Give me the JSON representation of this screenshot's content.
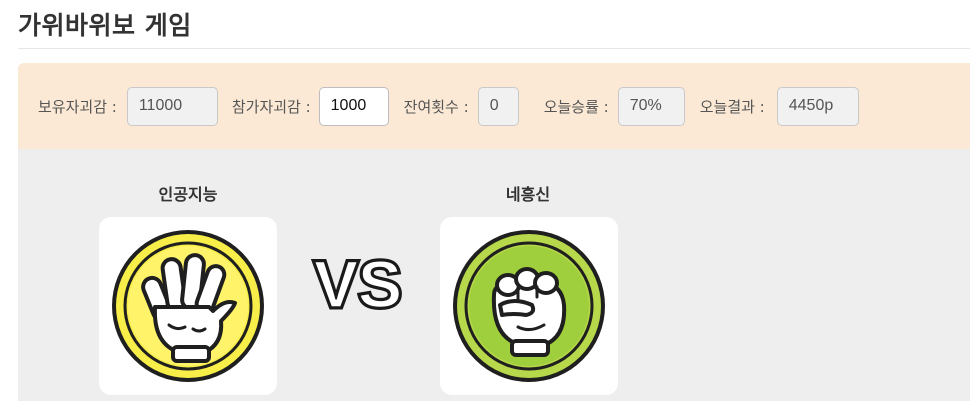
{
  "page": {
    "title": "가위바위보 게임"
  },
  "stats": {
    "owned_label": "보유자괴감 :",
    "owned_value": "11000",
    "bet_label": "참가자괴감 :",
    "bet_value": "1000",
    "remaining_label": "잔여횟수 :",
    "remaining_value": "0",
    "winrate_label": "오늘승률 :",
    "winrate_value": "70%",
    "result_label": "오늘결과 :",
    "result_value": "4450p"
  },
  "players": {
    "ai_name": "인공지능",
    "ai_hand_icon": "paper-hand-icon",
    "ai_hand_color": "#f7ee4a",
    "user_name": "네흥신",
    "user_hand_icon": "rock-fist-icon",
    "user_hand_color": "#b6d84a"
  },
  "versus": {
    "text": "VS"
  }
}
